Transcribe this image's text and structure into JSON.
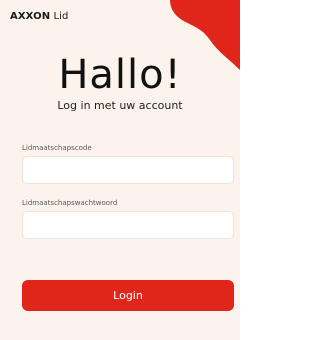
{
  "brand": {
    "name_bold": "AXXON",
    "name_rest": " Lid"
  },
  "hero": {
    "title": "Hallo!",
    "subtitle": "Log in met uw account"
  },
  "form": {
    "membership_code_label": "Lidmaatschapscode",
    "membership_code_value": "",
    "membership_password_label": "Lidmaatschapswachtwoord",
    "membership_password_value": ""
  },
  "login_button_label": "Login",
  "colors": {
    "accent": "#e0251b",
    "background": "#fbf3ec"
  }
}
